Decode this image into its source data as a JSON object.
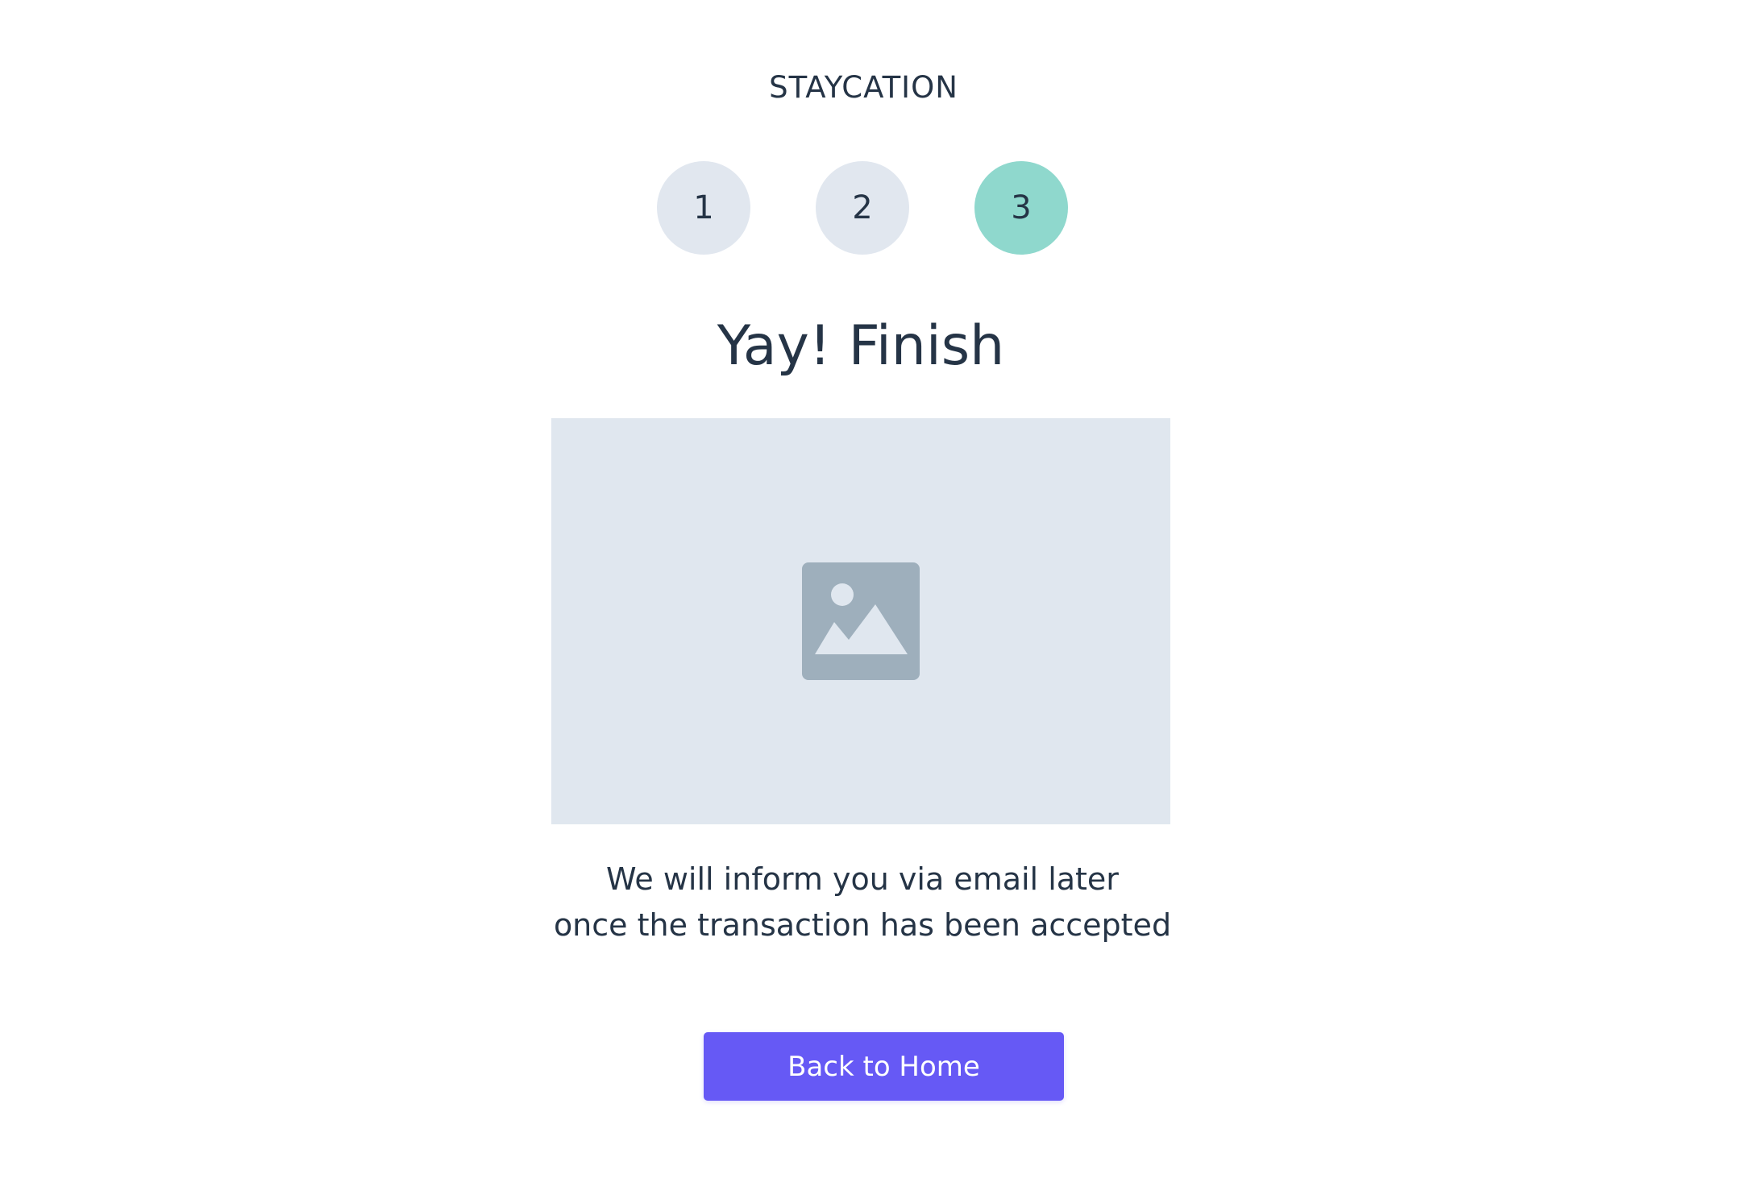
{
  "brand": {
    "name": "STAYCATION"
  },
  "stepper": {
    "steps": [
      {
        "label": "1",
        "active": false
      },
      {
        "label": "2",
        "active": false
      },
      {
        "label": "3",
        "active": true
      }
    ],
    "active_color": "#8fd8cd",
    "inactive_color": "#e1e7ef"
  },
  "main": {
    "title": "Yay! Finish",
    "image_icon": "image-placeholder-icon",
    "message_line_1": "We will inform you via email later",
    "message_line_2": "once the transaction has been accepted"
  },
  "actions": {
    "back_home_label": "Back to Home",
    "button_color": "#6659f5"
  }
}
